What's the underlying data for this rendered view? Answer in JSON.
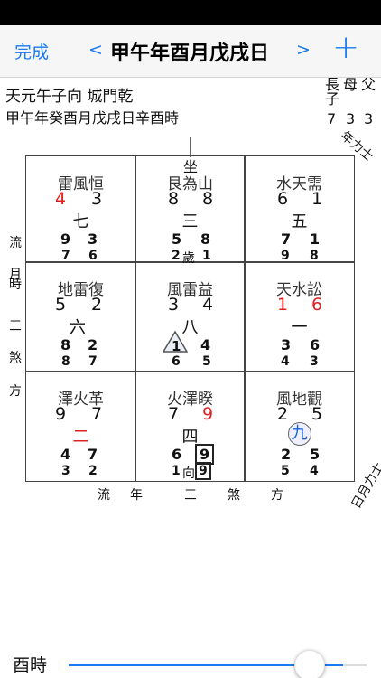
{
  "nav": {
    "done": "完成",
    "prev": "<",
    "title": "甲午年酉月戊戌日",
    "next": ">",
    "add": "+"
  },
  "info": {
    "line1": "天元午子向 城門乾",
    "line2": "甲午年癸酉月戊戌日辛酉時"
  },
  "side_top": {
    "col1_chars": "長子",
    "col1_num": "7",
    "col2_chars": "母",
    "col2_num": "3",
    "col3_chars": "父",
    "col3_num": "3",
    "rotated": "年力士"
  },
  "sit": "坐",
  "cells": [
    {
      "hex": "雷風恒",
      "mount": "4",
      "water": "3",
      "star": "七",
      "m1": "9",
      "m2": "3",
      "l1": "7",
      "l2": "6"
    },
    {
      "hex": "艮為山",
      "mount": "8",
      "water": "8",
      "star": "三",
      "m1": "5",
      "m2": "8",
      "l1": "2",
      "l_mid": "歲",
      "l2": "1"
    },
    {
      "hex": "水天需",
      "mount": "6",
      "water": "1",
      "star": "五",
      "m1": "7",
      "m2": "1",
      "l1": "9",
      "l2": "8"
    },
    {
      "hex": "地雷復",
      "mount": "5",
      "water": "2",
      "star": "六",
      "m1": "8",
      "m2": "2",
      "l1": "8",
      "l2": "7"
    },
    {
      "hex": "風雷益",
      "mount": "3",
      "water": "4",
      "star": "八",
      "m1": "1",
      "m2": "4",
      "l1": "6",
      "l2": "5"
    },
    {
      "hex": "天水訟",
      "mount": "1",
      "water": "6",
      "star": "一",
      "m1": "3",
      "m2": "6",
      "l1": "4",
      "l2": "3"
    },
    {
      "hex": "澤火革",
      "mount": "9",
      "water": "7",
      "star": "二",
      "m1": "4",
      "m2": "7",
      "l1": "3",
      "l2": "2"
    },
    {
      "hex": "火澤睽",
      "mount": "7",
      "water": "9",
      "star": "四",
      "m1": "6",
      "m2": "9",
      "l1": "1",
      "l_mid": "向",
      "l2": "9"
    },
    {
      "hex": "風地觀",
      "mount": "2",
      "water": "5",
      "star": "九",
      "m1": "2",
      "m2": "5",
      "l1": "5",
      "l2": "4"
    }
  ],
  "left_labels": {
    "l1": "流",
    "l2": "月",
    "l3": "時",
    "l4": "三",
    "l5": "煞",
    "l6": "方"
  },
  "bottom_labels": {
    "b1": "流",
    "b2": "年",
    "b3": "三",
    "b4": "煞",
    "b5": "方"
  },
  "corner_rotated": "日月力士",
  "footer": {
    "time": "酉時",
    "slider_value": 0.92
  },
  "colors": {
    "accent": "#1a7bf0",
    "red": "#e02020",
    "blue": "#2060d0"
  }
}
